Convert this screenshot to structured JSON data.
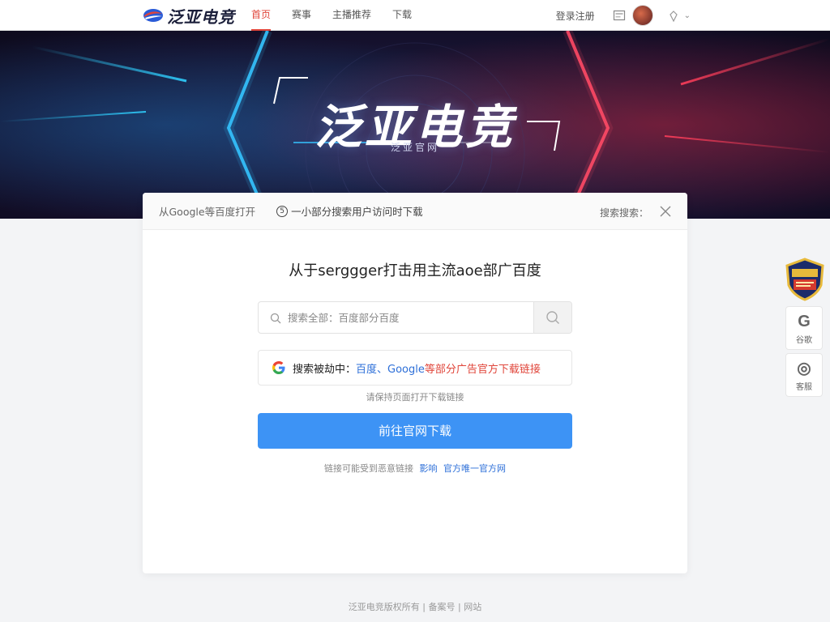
{
  "header": {
    "logo_text": "泛亚电竞",
    "nav": [
      {
        "label": "首页",
        "active": true
      },
      {
        "label": "赛事"
      },
      {
        "label": "主播推荐"
      },
      {
        "label": "下载"
      }
    ],
    "login_link": "登录注册"
  },
  "banner": {
    "title": "泛亚电竞",
    "subtitle": "泛亚官网"
  },
  "card": {
    "head_left": "从Google等百度打开",
    "head_badge": "5",
    "head_mid": "一小部分搜索用户访问时下载",
    "head_right": "搜索搜索：",
    "title": "从于serggger打击用主流aoe部广百度",
    "search": {
      "placeholder": "搜索全部：百度部分百度"
    },
    "notice": {
      "lead": "搜索被劫中：",
      "blue": "百度、Google",
      "red": "等部分广告官方下载链接"
    },
    "hint": "请保持页面打开下载链接",
    "cta": "前往官网下载",
    "foot_text": "链接可能受到恶意链接",
    "foot_link1": "影响",
    "foot_link2": "官方唯一官方网"
  },
  "side": {
    "badge_text": "保证官方",
    "btn1": {
      "icon": "G",
      "label": "谷歌"
    },
    "btn2": {
      "icon": "◎",
      "label": "客服"
    }
  },
  "footer": {
    "text": "泛亚电竞版权所有 | 备案号 | 网站"
  },
  "colors": {
    "accent_red": "#e0453a",
    "cta_blue": "#3d93f5",
    "link_blue": "#2d6fd8"
  }
}
